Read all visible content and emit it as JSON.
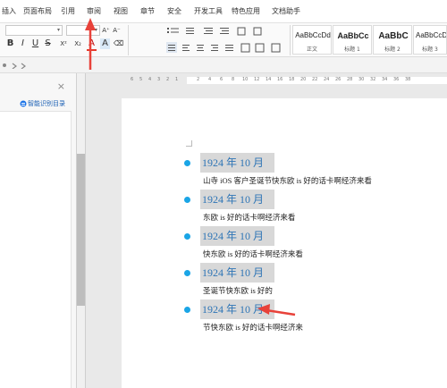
{
  "menu": {
    "items": [
      "插入",
      "页面布局",
      "引用",
      "审阅",
      "视图",
      "章节",
      "安全",
      "开发工具",
      "特色应用",
      "文档助手"
    ]
  },
  "ribbon": {
    "font_dropdown_caret": "▾",
    "size_dropdown_caret": "▾",
    "grow_font": "A⁺",
    "shrink_font": "A⁻",
    "bold": "B",
    "italic": "I",
    "underline": "U",
    "strikethrough": "S",
    "superscript": "X²",
    "subscript": "X₂",
    "font_color": "A",
    "highlight": "A",
    "clear_format": "⌫",
    "styles": [
      {
        "sample": "AaBbCcDd",
        "name": "正文"
      },
      {
        "sample": "AaBbCc",
        "name": "标题 1"
      },
      {
        "sample": "AaBbC",
        "name": "标题 2"
      },
      {
        "sample": "AaBbCcDd",
        "name": "标题 3"
      }
    ]
  },
  "nav": {
    "close": "×",
    "smart_toc": "智能识别目录"
  },
  "ruler": {
    "left_numbers": [
      "6",
      "5",
      "4",
      "3",
      "2",
      "1"
    ],
    "right_numbers": [
      "2",
      "4",
      "6",
      "8",
      "10",
      "12",
      "14",
      "16",
      "18",
      "20",
      "22",
      "24",
      "26",
      "28",
      "30",
      "32",
      "34",
      "36",
      "38"
    ]
  },
  "document": {
    "sections": [
      {
        "heading": "1924 年 10 月",
        "body": "山寺 iOS 客户圣诞节快东欧 is 好的话卡啊经济来看"
      },
      {
        "heading": "1924 年 10 月",
        "body": "东欧 is 好的话卡啊经济来看"
      },
      {
        "heading": "1924 年 10 月",
        "body": "快东欧 is 好的话卡啊经济来看"
      },
      {
        "heading": "1924 年 10 月",
        "body": "圣诞节快东欧 is 好的"
      },
      {
        "heading": "1924 年 10 月",
        "body": "节快东欧 is 好的话卡啊经济来"
      }
    ]
  },
  "colors": {
    "heading_text": "#2e75b6",
    "heading_bg": "#d8d8d8",
    "bullet": "#1aa5e6",
    "annotation_arrow": "#e8423a"
  },
  "watermark": "Baidu 经验"
}
